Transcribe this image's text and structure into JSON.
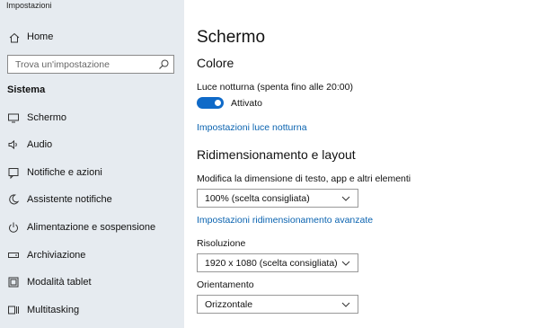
{
  "window": {
    "title": "Impostazioni"
  },
  "sidebar": {
    "home_label": "Home",
    "search_placeholder": "Trova un'impostazione",
    "section_label": "Sistema",
    "items": [
      {
        "label": "Schermo",
        "icon": "monitor-icon",
        "active": true
      },
      {
        "label": "Audio",
        "icon": "speaker-icon"
      },
      {
        "label": "Notifiche e azioni",
        "icon": "notification-icon"
      },
      {
        "label": "Assistente notifiche",
        "icon": "moon-icon"
      },
      {
        "label": "Alimentazione e sospensione",
        "icon": "power-icon"
      },
      {
        "label": "Archiviazione",
        "icon": "storage-icon"
      },
      {
        "label": "Modalità tablet",
        "icon": "tablet-icon"
      },
      {
        "label": "Multitasking",
        "icon": "multitasking-icon"
      }
    ]
  },
  "main": {
    "title": "Schermo",
    "color_heading": "Colore",
    "night_light_label": "Luce notturna (spenta fino alle 20:00)",
    "toggle_state": "Attivato",
    "night_light_link": "Impostazioni luce notturna",
    "scale_heading": "Ridimensionamento e layout",
    "size_label": "Modifica la dimensione di testo, app e altri elementi",
    "size_value": "100% (scelta consigliata)",
    "advanced_scaling_link": "Impostazioni ridimensionamento avanzate",
    "resolution_label": "Risoluzione",
    "resolution_value": "1920 x 1080 (scelta consigliata)",
    "orientation_label": "Orientamento",
    "orientation_value": "Orizzontale"
  },
  "colors": {
    "accent": "#0f6ac8",
    "link": "#0a63b0",
    "sidebar_bg": "#e6ebf0"
  }
}
